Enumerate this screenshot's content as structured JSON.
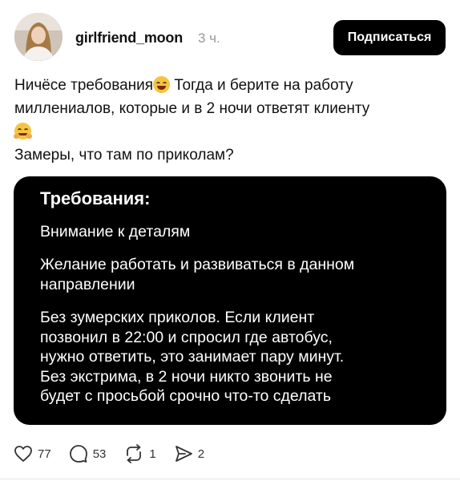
{
  "post": {
    "author": "girlfriend_moon",
    "time": "3 ч.",
    "follow_label": "Подписаться",
    "text_lines": [
      "Ничёсе требования",
      " Тогда и берите на работу",
      "миллениалов, которые и в 2 ночи ответят клиенту",
      "Замеры, что там по приколам?"
    ],
    "emojis": [
      "face-with-tears-of-joy-icon",
      "hugging-face-icon"
    ]
  },
  "card": {
    "title": "Требования:",
    "items": [
      [
        "Внимание к деталям"
      ],
      [
        "Желание работать и развиваться в данном",
        "направлении"
      ],
      [
        "Без зумерских приколов. Если клиент",
        "позвонил в 22:00 и спросил где автобус,",
        "нужно ответить, это занимает пару минут.",
        "Без экстрима, в 2 ночи никто звонить не",
        "будет с просьбой срочно что-то сделать"
      ]
    ]
  },
  "actions": {
    "likes": "77",
    "comments": "53",
    "reposts": "1",
    "shares": "2"
  }
}
